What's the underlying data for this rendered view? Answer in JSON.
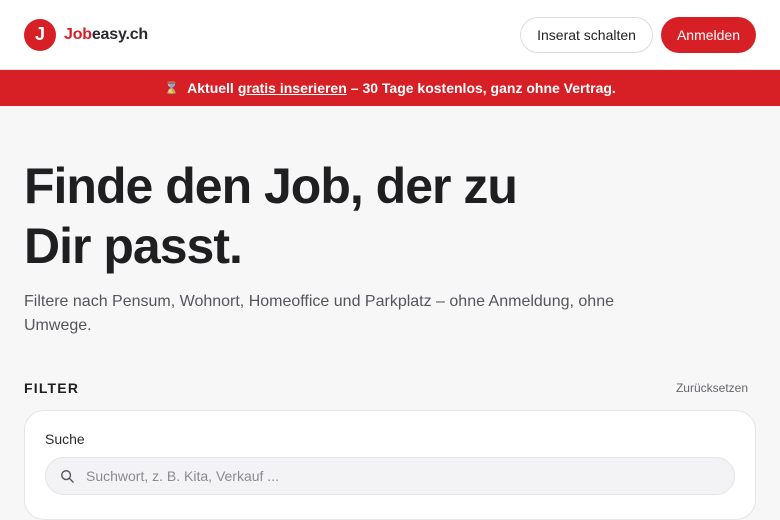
{
  "header": {
    "logo_letter": "J",
    "brand_accent": "Job",
    "brand_rest": "easy.ch",
    "post_ad_label": "Inserat schalten",
    "login_label": "Anmelden"
  },
  "promo": {
    "icon": "hourglass-icon",
    "prefix": "Aktuell",
    "link": "gratis inserieren",
    "suffix": "– 30 Tage kostenlos, ganz ohne Vertrag."
  },
  "hero": {
    "title": "Finde den Job, der zu Dir passt.",
    "subtitle": "Filtere nach Pensum, Wohnort, Homeoffice und Parkplatz – ohne Anmeldung, ohne Umwege."
  },
  "filter": {
    "title": "FILTER",
    "reset_label": "Zurücksetzen",
    "search_label": "Suche",
    "search_placeholder": "Suchwort, z. B. Kita, Verkauf ...",
    "search_value": ""
  },
  "colors": {
    "brand_red": "#d71f26",
    "background": "#f7f7f8"
  }
}
